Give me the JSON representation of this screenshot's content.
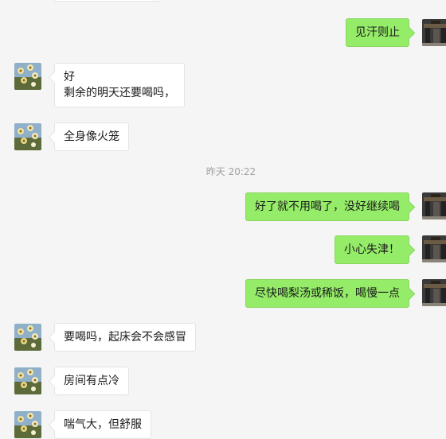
{
  "messages": [
    {
      "side": "left",
      "text": "",
      "avatar": "daisy-avatar"
    },
    {
      "side": "right",
      "text": "见汗则止",
      "avatar": "gate-avatar"
    },
    {
      "side": "left",
      "lines": [
        "好",
        "剩余的明天还要喝吗，"
      ],
      "avatar": "daisy-avatar"
    },
    {
      "side": "left",
      "text": "全身像火笼",
      "avatar": "daisy-avatar"
    },
    {
      "timestamp": "昨天 20:22"
    },
    {
      "side": "right",
      "text": "好了就不用喝了，没好继续喝",
      "avatar": "gate-avatar"
    },
    {
      "side": "right",
      "text": "小心失津！",
      "avatar": "gate-avatar"
    },
    {
      "side": "right",
      "text": "尽快喝梨汤或稀饭，喝慢一点",
      "avatar": "gate-avatar"
    },
    {
      "side": "left",
      "text": "要喝吗，起床会不会感冒",
      "avatar": "daisy-avatar"
    },
    {
      "side": "left",
      "text": "房间有点冷",
      "avatar": "daisy-avatar"
    },
    {
      "side": "left",
      "text": "喘气大，但舒服",
      "avatar": "daisy-avatar"
    }
  ],
  "colors": {
    "incoming_bubble": "#ffffff",
    "outgoing_bubble": "#95ec69",
    "background": "#f5f5f5"
  }
}
